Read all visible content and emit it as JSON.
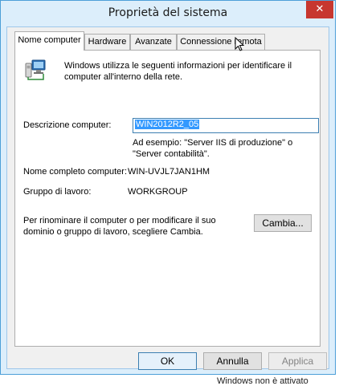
{
  "window": {
    "title": "Proprietà del sistema",
    "close_glyph": "✕"
  },
  "tabs": [
    {
      "label": "Nome computer",
      "active": true
    },
    {
      "label": "Hardware",
      "active": false
    },
    {
      "label": "Avanzate",
      "active": false
    },
    {
      "label": "Connessione remota",
      "active": false
    }
  ],
  "panel": {
    "intro_icon": "computer-network-icon",
    "intro_text": "Windows utilizza le seguenti informazioni per identificare il computer all'interno della rete.",
    "description_label": "Descrizione computer:",
    "description_value": "WIN2012R2_05",
    "example_text": "Ad esempio: \"Server IIS di produzione\" o \"Server contabilità\".",
    "full_name_label": "Nome completo computer:",
    "full_name_value": "WIN-UVJL7JAN1HM",
    "workgroup_label": "Gruppo di lavoro:",
    "workgroup_value": "WORKGROUP",
    "rename_text": "Per rinominare il computer o per modificare il suo dominio o gruppo di lavoro, scegliere Cambia.",
    "change_button": "Cambia..."
  },
  "buttons": {
    "ok": "OK",
    "cancel": "Annulla",
    "apply": "Applica"
  },
  "background_text": "Windows non è attivato",
  "colors": {
    "title_bg": "#dceefb",
    "close_bg": "#c7372f",
    "selection": "#3399ff"
  }
}
